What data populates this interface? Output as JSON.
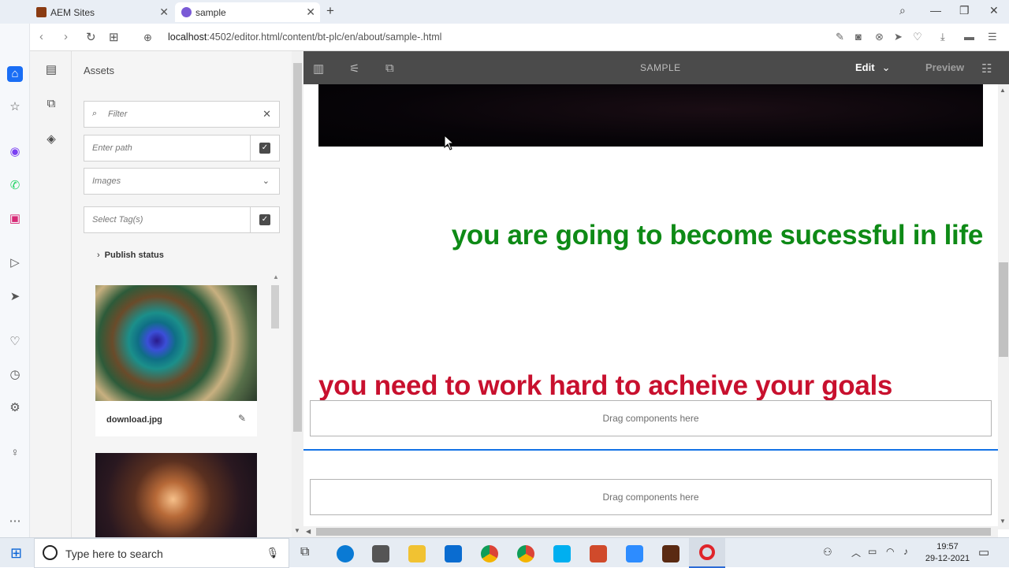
{
  "browser": {
    "tabs": [
      {
        "label": "AEM Sites"
      },
      {
        "label": "sample"
      }
    ],
    "url_host": "localhost",
    "url_path": ":4502/editor.html/content/bt-plc/en/about/sample-.html"
  },
  "panel": {
    "title": "Assets",
    "filter_placeholder": "Filter",
    "path_placeholder": "Enter path",
    "type_select": "Images",
    "tags_placeholder": "Select Tag(s)",
    "publish_status": "Publish status",
    "cards": [
      {
        "name": "download.jpg"
      },
      {
        "name": ""
      }
    ]
  },
  "editor": {
    "title": "SAMPLE",
    "edit_label": "Edit",
    "preview_label": "Preview",
    "text_green": "you are going to become sucessful in life",
    "text_red": "you need to work hard to acheive your goals",
    "dropzone_1": "Drag components here",
    "dropzone_2": "Drag components here"
  },
  "taskbar": {
    "search_placeholder": "Type here to search",
    "time": "19:57",
    "date": "29-12-2021"
  },
  "colors": {
    "green_text": "#0e8a16",
    "red_text": "#c8102e",
    "editor_bar": "#4b4b4b",
    "selection_line": "#1473e6"
  }
}
